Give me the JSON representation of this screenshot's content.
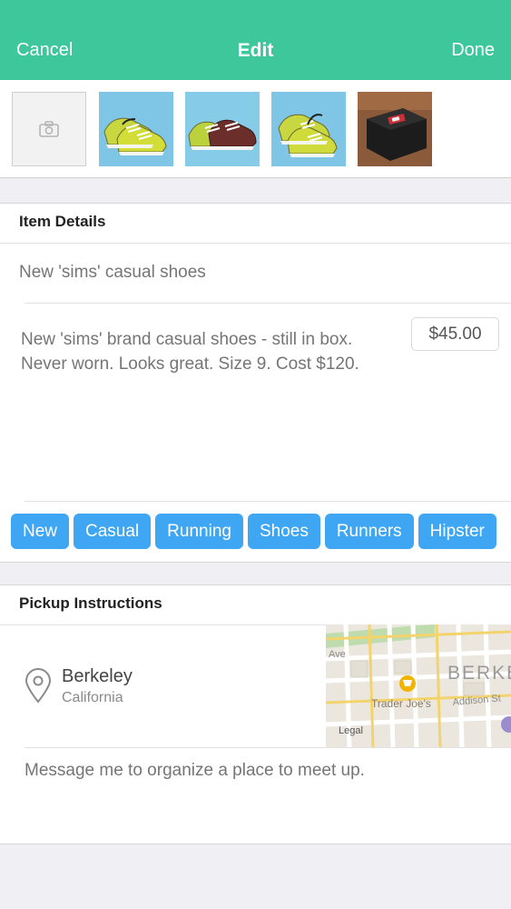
{
  "header": {
    "cancel_label": "Cancel",
    "title": "Edit",
    "done_label": "Done",
    "background": "#3ec79a"
  },
  "photos": {
    "add_photo_icon": "camera-icon",
    "thumbnails": [
      {
        "name": "shoe-photo-1"
      },
      {
        "name": "shoe-photo-2"
      },
      {
        "name": "shoe-photo-3"
      },
      {
        "name": "shoebox-photo"
      }
    ]
  },
  "item_details": {
    "section_title": "Item Details",
    "title_value": "New 'sims' casual shoes",
    "description_line1": "New 'sims' brand casual shoes - still in box.",
    "description_line2": "Never worn. Looks great. Size 9. Cost $120.",
    "price": "$45.00",
    "tag_color": "#3ea6f2",
    "tags": [
      "New",
      "Casual",
      "Running",
      "Shoes",
      "Runners",
      "Hipster"
    ]
  },
  "pickup": {
    "section_title": "Pickup Instructions",
    "location_icon": "map-pin-icon",
    "city": "Berkeley",
    "state": "California",
    "message": "Message me to organize a place to meet up.",
    "map": {
      "street_1": "Ave",
      "place_label": "BERKE",
      "poi_label": "Trader Joe's",
      "street_2": "Addison St",
      "legal_label": "Legal"
    }
  }
}
